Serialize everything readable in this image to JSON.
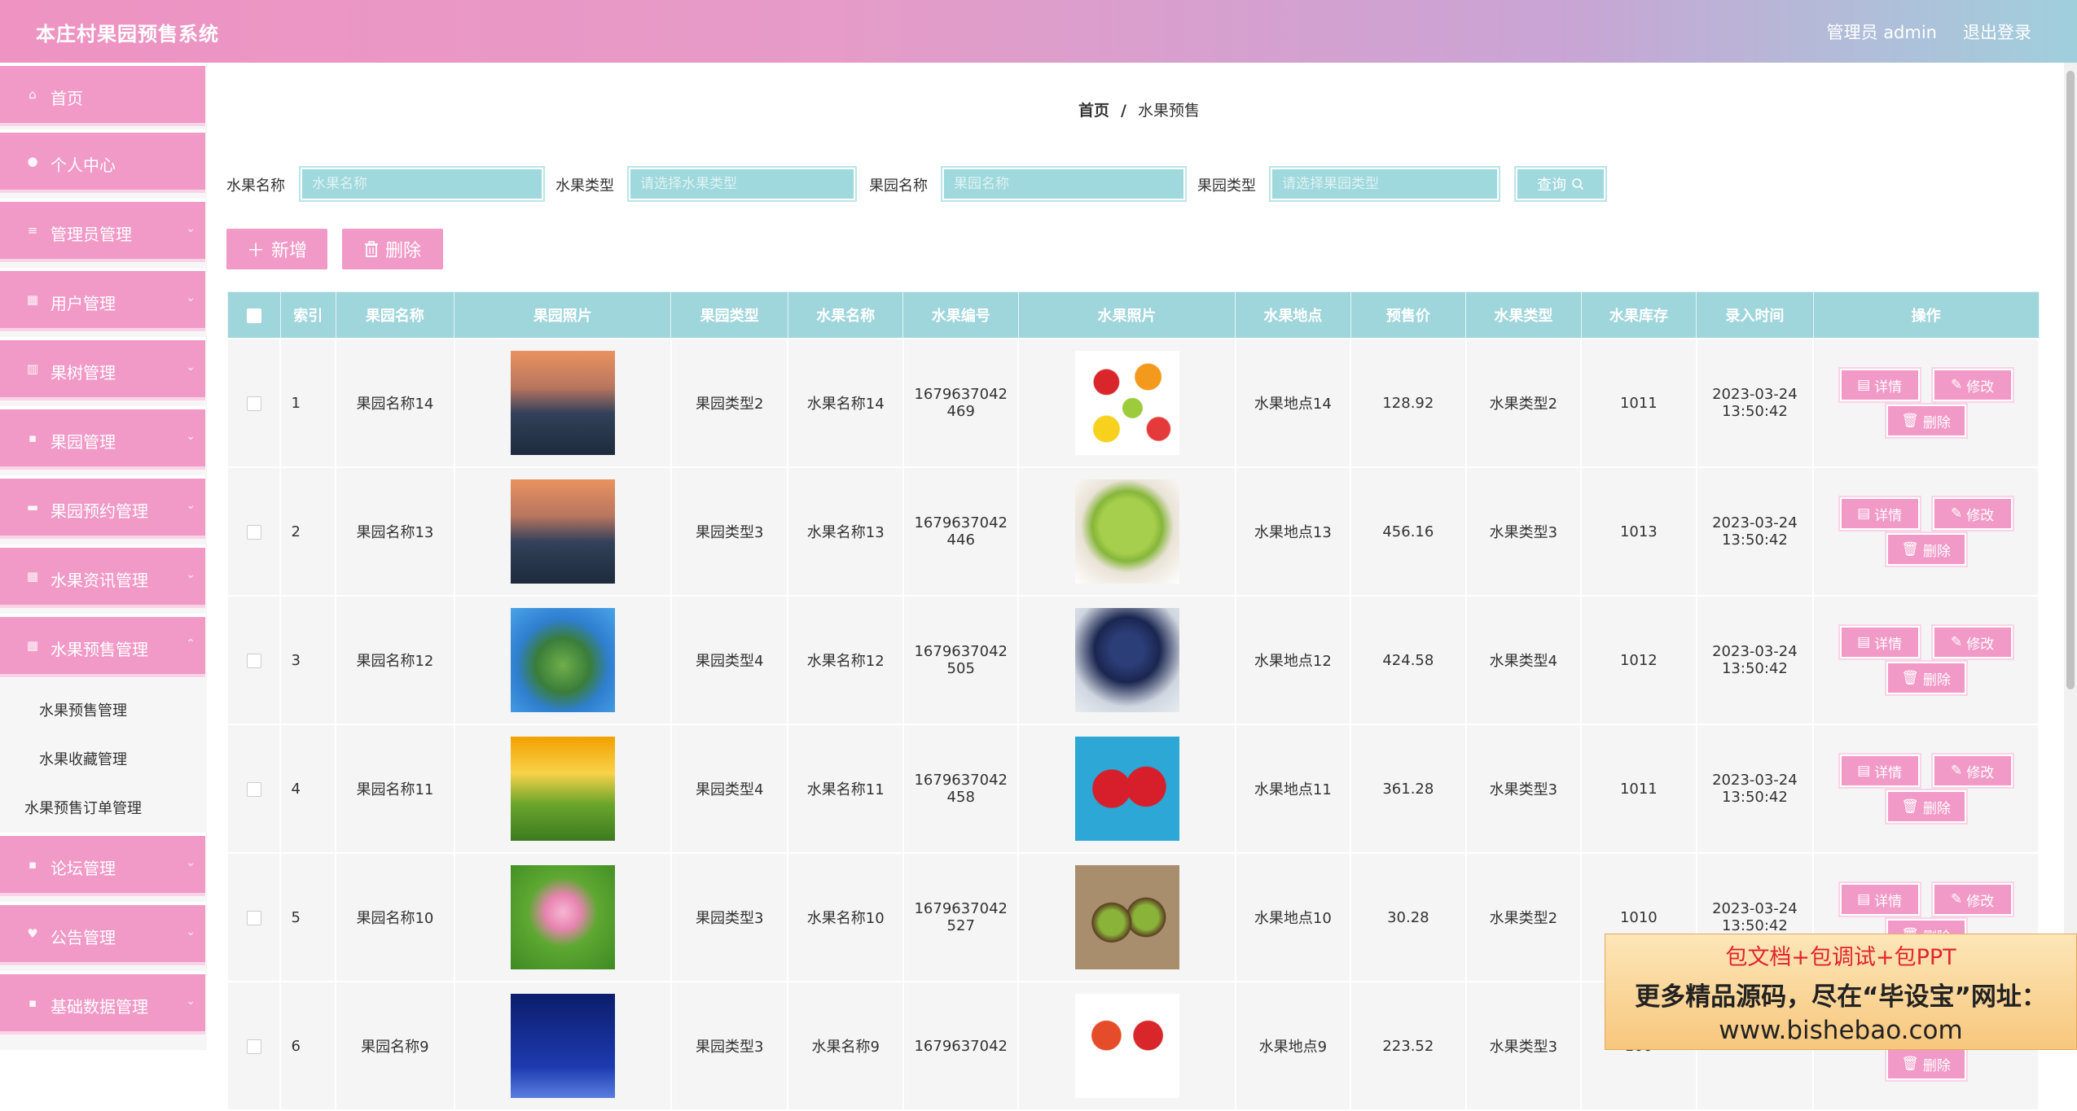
{
  "header": {
    "title": "本庄村果园预售系统",
    "user": "管理员 admin",
    "logout": "退出登录"
  },
  "sidebar": {
    "items": [
      {
        "label": "首页",
        "icon": "home-icon"
      },
      {
        "label": "个人中心",
        "icon": "user-icon"
      },
      {
        "label": "管理员管理",
        "icon": "list-icon"
      },
      {
        "label": "用户管理",
        "icon": "grid-icon"
      },
      {
        "label": "果树管理",
        "icon": "bar-chart-icon"
      },
      {
        "label": "果园管理",
        "icon": "apps-icon"
      },
      {
        "label": "果园预约管理",
        "icon": "message-icon"
      },
      {
        "label": "水果资讯管理",
        "icon": "grid-icon"
      },
      {
        "label": "水果预售管理",
        "icon": "grid-icon"
      },
      {
        "label": "论坛管理",
        "icon": "apps-icon"
      },
      {
        "label": "公告管理",
        "icon": "bell-icon"
      },
      {
        "label": "基础数据管理",
        "icon": "apps-icon"
      }
    ],
    "sub_items": [
      "水果预售管理",
      "水果收藏管理",
      "水果预售订单管理"
    ]
  },
  "breadcrumb": {
    "home": "首页",
    "sep": "/",
    "current": "水果预售"
  },
  "filters": {
    "fruit_name_label": "水果名称",
    "fruit_name_placeholder": "水果名称",
    "fruit_type_label": "水果类型",
    "fruit_type_placeholder": "请选择水果类型",
    "orchard_name_label": "果园名称",
    "orchard_name_placeholder": "果园名称",
    "orchard_type_label": "果园类型",
    "orchard_type_placeholder": "请选择果园类型",
    "query_label": "查询"
  },
  "actions": {
    "add_label": "新增",
    "delete_label": "删除"
  },
  "table": {
    "headers": [
      "索引",
      "果园名称",
      "果园照片",
      "果园类型",
      "水果名称",
      "水果编号",
      "水果照片",
      "水果地点",
      "预售价",
      "水果类型",
      "水果库存",
      "录入时间",
      "操作"
    ],
    "op_labels": {
      "detail": "详情",
      "edit": "修改",
      "delete": "删除"
    },
    "rows": [
      {
        "index": "1",
        "orchard_name": "果园名称14",
        "orchard_type": "果园类型2",
        "fruit_name": "水果名称14",
        "code_line1": "1679637042",
        "code_line2": "469",
        "location": "水果地点14",
        "price": "128.92",
        "fruit_type": "水果类型2",
        "stock": "1011",
        "time_line1": "2023-03-24",
        "time_line2": "13:50:42"
      },
      {
        "index": "2",
        "orchard_name": "果园名称13",
        "orchard_type": "果园类型3",
        "fruit_name": "水果名称13",
        "code_line1": "1679637042",
        "code_line2": "446",
        "location": "水果地点13",
        "price": "456.16",
        "fruit_type": "水果类型3",
        "stock": "1013",
        "time_line1": "2023-03-24",
        "time_line2": "13:50:42"
      },
      {
        "index": "3",
        "orchard_name": "果园名称12",
        "orchard_type": "果园类型4",
        "fruit_name": "水果名称12",
        "code_line1": "1679637042",
        "code_line2": "505",
        "location": "水果地点12",
        "price": "424.58",
        "fruit_type": "水果类型4",
        "stock": "1012",
        "time_line1": "2023-03-24",
        "time_line2": "13:50:42"
      },
      {
        "index": "4",
        "orchard_name": "果园名称11",
        "orchard_type": "果园类型4",
        "fruit_name": "水果名称11",
        "code_line1": "1679637042",
        "code_line2": "458",
        "location": "水果地点11",
        "price": "361.28",
        "fruit_type": "水果类型3",
        "stock": "1011",
        "time_line1": "2023-03-24",
        "time_line2": "13:50:42"
      },
      {
        "index": "5",
        "orchard_name": "果园名称10",
        "orchard_type": "果园类型3",
        "fruit_name": "水果名称10",
        "code_line1": "1679637042",
        "code_line2": "527",
        "location": "水果地点10",
        "price": "30.28",
        "fruit_type": "水果类型2",
        "stock": "1010",
        "time_line1": "2023-03-24",
        "time_line2": "13:50:42"
      },
      {
        "index": "6",
        "orchard_name": "果园名称9",
        "orchard_type": "果园类型3",
        "fruit_name": "水果名称9",
        "code_line1": "1679637042",
        "code_line2": "",
        "location": "水果地点9",
        "price": "223.52",
        "fruit_type": "水果类型3",
        "stock": "100",
        "time_line1": "",
        "time_line2": ""
      }
    ]
  },
  "ad": {
    "line1": "包文档+包调试+包PPT",
    "line2": "更多精品源码，尽在“毕设宝”网址：",
    "line3": "www.bishebao.com"
  },
  "colors": {
    "pink": "#f19ac7",
    "teal": "#9fd6dc"
  }
}
